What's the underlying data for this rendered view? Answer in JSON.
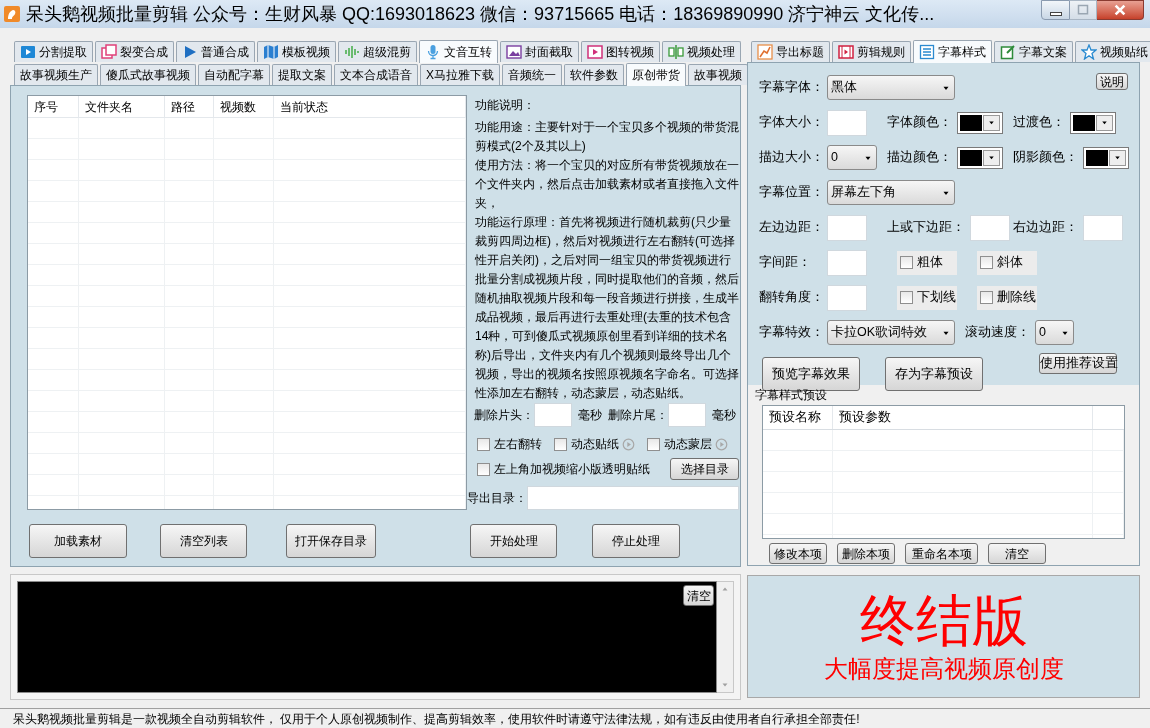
{
  "window": {
    "title": "呆头鹅视频批量剪辑 公众号：生财风暴 QQ:1693018623 微信：93715665 电话：18369890990 济宁神云 文化传..."
  },
  "main_tabs": [
    {
      "label": "分割提取",
      "selected": false
    },
    {
      "label": "裂变合成",
      "selected": false
    },
    {
      "label": "普通合成",
      "selected": false
    },
    {
      "label": "模板视频",
      "selected": false
    },
    {
      "label": "超级混剪",
      "selected": false
    },
    {
      "label": "文音互转",
      "selected": true
    },
    {
      "label": "封面截取",
      "selected": false
    },
    {
      "label": "图转视频",
      "selected": false
    },
    {
      "label": "视频处理",
      "selected": false
    }
  ],
  "sub_tabs": [
    {
      "label": "故事视频生产",
      "selected": false
    },
    {
      "label": "傻瓜式故事视频",
      "selected": false
    },
    {
      "label": "自动配字幕",
      "selected": false
    },
    {
      "label": "提取文案",
      "selected": false
    },
    {
      "label": "文本合成语音",
      "selected": false
    },
    {
      "label": "X马拉雅下载",
      "selected": false
    },
    {
      "label": "音频统一",
      "selected": false
    },
    {
      "label": "软件参数",
      "selected": false
    },
    {
      "label": "原创带货",
      "selected": true
    },
    {
      "label": "故事视频",
      "selected": false
    }
  ],
  "file_table": {
    "columns": [
      "序号",
      "文件夹名",
      "路径",
      "视频数",
      "当前状态"
    ]
  },
  "description": {
    "heading": "功能说明：",
    "paragraphs": [
      "功能用途：主要针对于一个宝贝多个视频的带货混剪模式(2个及其以上)",
      "使用方法：将一个宝贝的对应所有带货视频放在一个文件夹内，然后点击加载素材或者直接拖入文件夹，",
      "功能运行原理：首先将视频进行随机裁剪(只少量裁剪四周边框)，然后对视频进行左右翻转(可选择性开启关闭)，之后对同一组宝贝的带货视频进行批量分割成视频片段，同时提取他们的音频，然后随机抽取视频片段和每一段音频进行拼接，生成半成品视频，最后再进行去重处理(去重的技术包含14种，可到傻瓜式视频原创里看到详细的技术名称)后导出，文件夹内有几个视频则最终导出几个视频，导出的视频名按照原视频名字命名。可选择性添加左右翻转，动态蒙层，动态贴纸。"
    ]
  },
  "trim": {
    "head_label": "删除片头：",
    "head_unit": "毫秒",
    "tail_label": "删除片尾：",
    "tail_unit": "毫秒"
  },
  "options": [
    {
      "label": "左右翻转",
      "checked": false
    },
    {
      "label": "动态贴纸",
      "checked": false,
      "help_icon": true
    },
    {
      "label": "动态蒙层",
      "checked": false,
      "help_icon": true
    },
    {
      "label": "左上角加视频缩小版透明贴纸",
      "checked": false
    }
  ],
  "choose_dir_button": "选择目录",
  "export_dir": {
    "label": "导出目录："
  },
  "actions": [
    "加载素材",
    "清空列表",
    "打开保存目录",
    "开始处理",
    "停止处理"
  ],
  "log": {
    "clear_button": "清空"
  },
  "right_tabs": [
    {
      "label": "导出标题",
      "selected": false
    },
    {
      "label": "剪辑规则",
      "selected": false
    },
    {
      "label": "字幕样式",
      "selected": true
    },
    {
      "label": "字幕文案",
      "selected": false
    },
    {
      "label": "视频贴纸",
      "selected": false
    }
  ],
  "help_button": "说明",
  "style_rows": [
    [
      {
        "kind": "select",
        "label": "字幕字体：",
        "value": "黑体",
        "wide": true
      }
    ],
    [
      {
        "kind": "input",
        "label": "字体大小："
      },
      {
        "kind": "color",
        "label": "字体颜色：",
        "color": "#000000"
      },
      {
        "kind": "color",
        "label": "过渡色：",
        "color": "#000000"
      }
    ],
    [
      {
        "kind": "select",
        "label": "描边大小：",
        "value": "0"
      },
      {
        "kind": "color",
        "label": "描边颜色：",
        "color": "#000000"
      },
      {
        "kind": "color",
        "label": "阴影颜色：",
        "color": "#000000"
      }
    ],
    [
      {
        "kind": "select",
        "label": "字幕位置：",
        "value": "屏幕左下角",
        "wide": true
      }
    ],
    [
      {
        "kind": "input",
        "label": "左边边距："
      },
      {
        "kind": "input",
        "label": "上或下边距："
      },
      {
        "kind": "input",
        "label": "右边边距："
      }
    ],
    [
      {
        "kind": "input",
        "label": "字间距："
      },
      {
        "kind": "checkbox",
        "label": "粗体",
        "checked": false
      },
      {
        "kind": "checkbox",
        "label": "斜体",
        "checked": false
      }
    ],
    [
      {
        "kind": "input",
        "label": "翻转角度："
      },
      {
        "kind": "checkbox",
        "label": "下划线",
        "checked": false
      },
      {
        "kind": "checkbox",
        "label": "删除线",
        "checked": false
      }
    ],
    [
      {
        "kind": "select",
        "label": "字幕特效：",
        "value": "卡拉OK歌词特效",
        "wide": true
      },
      {
        "kind": "select",
        "label": "滚动速度：",
        "value": "0"
      }
    ]
  ],
  "style_buttons": [
    "预览字幕效果",
    "存为字幕预设",
    "使用推荐设置"
  ],
  "presets": {
    "title": "字幕样式预设",
    "columns": [
      "预设名称",
      "预设参数"
    ],
    "buttons": [
      "修改本项",
      "删除本项",
      "重命名本项",
      "清空"
    ]
  },
  "banner": {
    "title": "终结版",
    "subtitle": "大幅度提高视频原创度"
  },
  "status_bar": "呆头鹅视频批量剪辑是一款视频全自动剪辑软件， 仅用于个人原创视频制作、提高剪辑效率，使用软件时请遵守法律法规，如有违反由使用者自行承担全部责任!"
}
